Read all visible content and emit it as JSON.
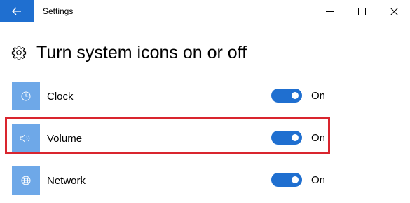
{
  "window": {
    "title": "Settings",
    "back_icon": "back-arrow-icon",
    "controls": [
      "minimize-icon",
      "maximize-icon",
      "close-icon"
    ]
  },
  "page": {
    "icon": "gear-icon",
    "title": "Turn system icons on or off"
  },
  "items": [
    {
      "label": "Clock",
      "icon": "clock-icon",
      "state": "On",
      "enabled": true
    },
    {
      "label": "Volume",
      "icon": "volume-icon",
      "state": "On",
      "enabled": true
    },
    {
      "label": "Network",
      "icon": "network-globe-icon",
      "state": "On",
      "enabled": true
    }
  ],
  "highlighted_item": "Volume",
  "colors": {
    "accent": "#1f6fd0",
    "icon_tile": "#6ea8e8",
    "highlight_border": "#d9252e"
  }
}
